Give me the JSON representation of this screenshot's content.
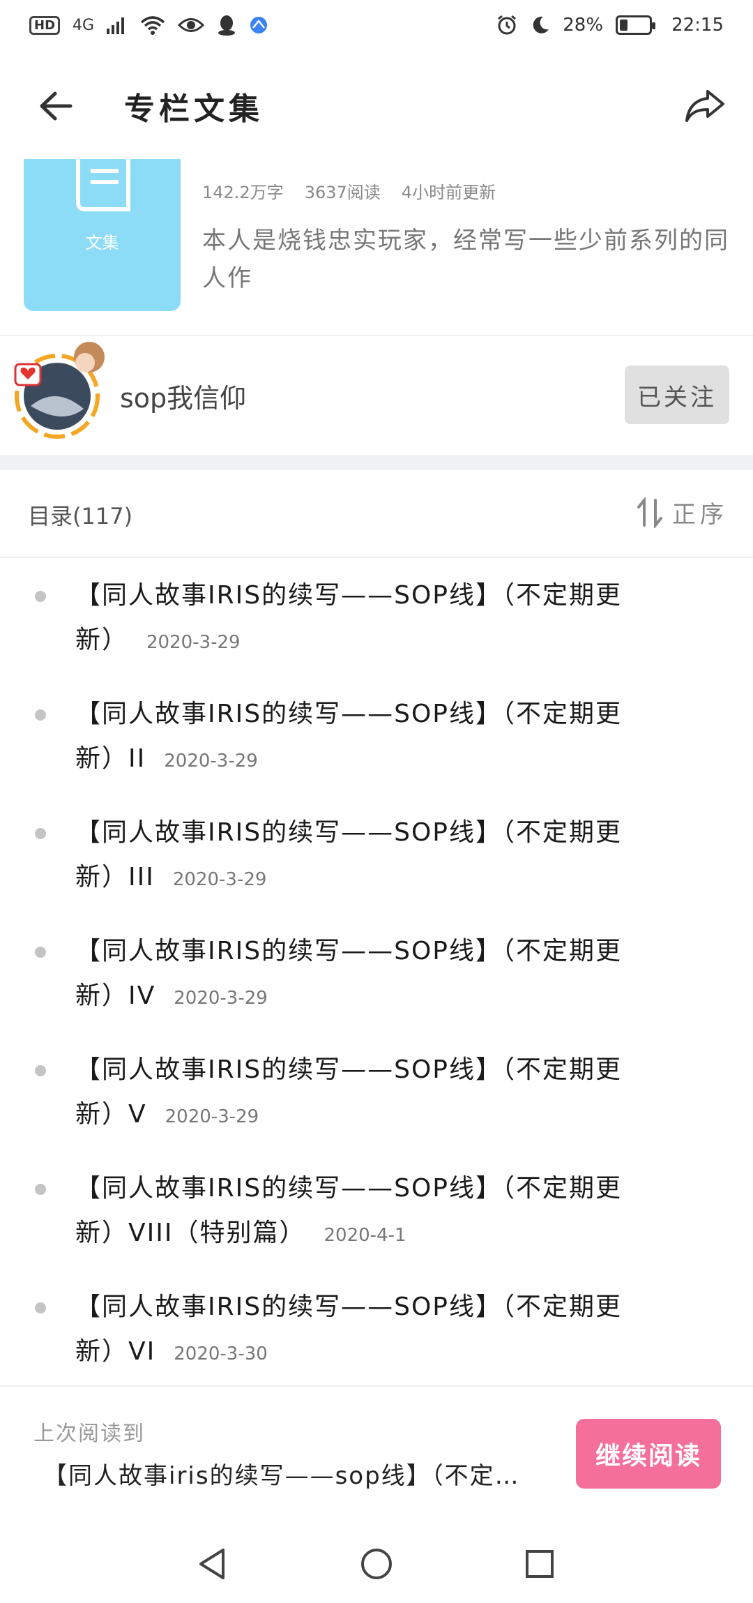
{
  "status_bar": {
    "left_badge": "HD",
    "network": "4G",
    "battery_percent": "28%",
    "battery_level": 0.28,
    "time": "22:15"
  },
  "header": {
    "title": "专栏文集",
    "back_icon": "arrow-left-icon",
    "share_icon": "share-icon"
  },
  "collection": {
    "cover_label": "文集",
    "cover_color": "#8ddcf7",
    "word_count": "142.2万字",
    "read_count": "3637阅读",
    "updated": "4小时前更新",
    "description": "本人是烧钱忠实玩家，经常写一些少前系列的同人作"
  },
  "author": {
    "name": "sop我信仰",
    "follow_label": "已关注"
  },
  "toc": {
    "title": "目录(117)",
    "sort_label": "正序"
  },
  "chapters": [
    {
      "title": "【同人故事IRIS的续写——SOP线】（不定期更新）",
      "date": "2020-3-29"
    },
    {
      "title": "【同人故事IRIS的续写——SOP线】（不定期更新）II",
      "date": "2020-3-29"
    },
    {
      "title": "【同人故事IRIS的续写——SOP线】（不定期更新）III",
      "date": "2020-3-29"
    },
    {
      "title": "【同人故事IRIS的续写——SOP线】（不定期更新）IV",
      "date": "2020-3-29"
    },
    {
      "title": "【同人故事IRIS的续写——SOP线】（不定期更新）V",
      "date": "2020-3-29"
    },
    {
      "title": "【同人故事IRIS的续写——SOP线】（不定期更新）VIII（特别篇）",
      "date": "2020-4-1"
    },
    {
      "title": "【同人故事IRIS的续写——SOP线】（不定期更新）VI",
      "date": "2020-3-30"
    }
  ],
  "last_read": {
    "label": "上次阅读到",
    "title": "【同人故事iris的续写——sop线】（不定…",
    "continue_label": "继续阅读",
    "button_color": "#f46f9a"
  },
  "nav": {
    "back": "triangle-back-icon",
    "home": "circle-home-icon",
    "recent": "square-recent-icon"
  }
}
